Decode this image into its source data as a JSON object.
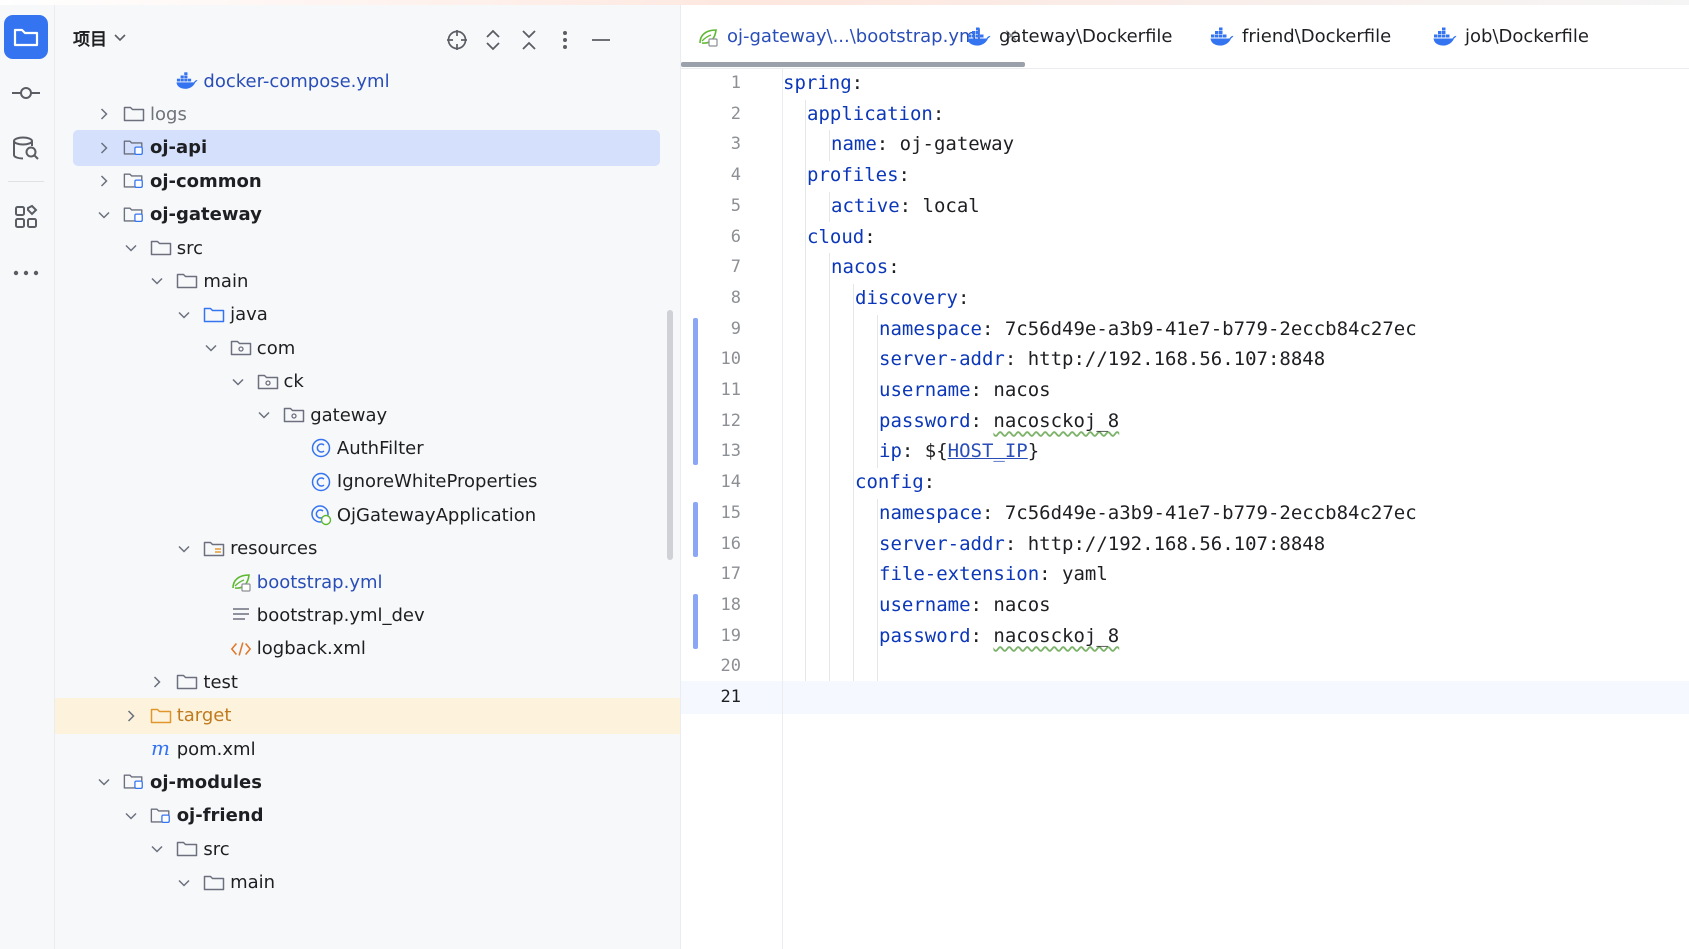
{
  "panel": {
    "title": "项目"
  },
  "tree": [
    {
      "label": "docker-compose.yml",
      "icon": "docker-icon",
      "indent": 4,
      "arrow": "none",
      "style": "blue"
    },
    {
      "label": "logs",
      "icon": "folder-icon",
      "indent": 2,
      "arrow": "right",
      "style": "gray"
    },
    {
      "label": "oj-api",
      "icon": "module-folder-icon",
      "indent": 2,
      "arrow": "right",
      "style": "bold",
      "selected": true
    },
    {
      "label": "oj-common",
      "icon": "module-folder-icon",
      "indent": 2,
      "arrow": "right",
      "style": "bold"
    },
    {
      "label": "oj-gateway",
      "icon": "module-folder-icon",
      "indent": 2,
      "arrow": "down",
      "style": "bold"
    },
    {
      "label": "src",
      "icon": "folder-icon",
      "indent": 3,
      "arrow": "down",
      "style": ""
    },
    {
      "label": "main",
      "icon": "folder-icon",
      "indent": 4,
      "arrow": "down",
      "style": ""
    },
    {
      "label": "java",
      "icon": "source-folder-icon",
      "indent": 5,
      "arrow": "down",
      "style": ""
    },
    {
      "label": "com",
      "icon": "package-icon",
      "indent": 6,
      "arrow": "down",
      "style": ""
    },
    {
      "label": "ck",
      "icon": "package-icon",
      "indent": 7,
      "arrow": "down",
      "style": ""
    },
    {
      "label": "gateway",
      "icon": "package-icon",
      "indent": 8,
      "arrow": "down",
      "style": ""
    },
    {
      "label": "AuthFilter",
      "icon": "class-icon",
      "indent": 9,
      "arrow": "none",
      "style": ""
    },
    {
      "label": "IgnoreWhiteProperties",
      "icon": "class-icon",
      "indent": 9,
      "arrow": "none",
      "style": ""
    },
    {
      "label": "OjGatewayApplication",
      "icon": "spring-class-icon",
      "indent": 9,
      "arrow": "none",
      "style": ""
    },
    {
      "label": "resources",
      "icon": "resources-folder-icon",
      "indent": 5,
      "arrow": "down",
      "style": ""
    },
    {
      "label": "bootstrap.yml",
      "icon": "spring-yaml-icon",
      "indent": 6,
      "arrow": "none",
      "style": "blue"
    },
    {
      "label": "bootstrap.yml_dev",
      "icon": "text-file-icon",
      "indent": 6,
      "arrow": "none",
      "style": ""
    },
    {
      "label": "logback.xml",
      "icon": "xml-icon",
      "indent": 6,
      "arrow": "none",
      "style": ""
    },
    {
      "label": "test",
      "icon": "folder-icon",
      "indent": 4,
      "arrow": "right",
      "style": ""
    },
    {
      "label": "target",
      "icon": "excluded-folder-icon",
      "indent": 3,
      "arrow": "right",
      "style": "orange",
      "highlight": true
    },
    {
      "label": "pom.xml",
      "icon": "maven-icon",
      "indent": 3,
      "arrow": "none",
      "style": ""
    },
    {
      "label": "oj-modules",
      "icon": "module-folder-icon",
      "indent": 2,
      "arrow": "down",
      "style": "bold"
    },
    {
      "label": "oj-friend",
      "icon": "module-folder-icon",
      "indent": 3,
      "arrow": "down",
      "style": "bold"
    },
    {
      "label": "src",
      "icon": "folder-icon",
      "indent": 4,
      "arrow": "down",
      "style": ""
    },
    {
      "label": "main",
      "icon": "folder-icon",
      "indent": 5,
      "arrow": "down",
      "style": ""
    }
  ],
  "tabs": [
    {
      "label": "oj-gateway\\...\\bootstrap.yml",
      "icon": "spring-yaml-icon",
      "active": true
    },
    {
      "label": "gateway\\Dockerfile",
      "icon": "docker-icon"
    },
    {
      "label": "friend\\Dockerfile",
      "icon": "docker-icon"
    },
    {
      "label": "job\\Dockerfile",
      "icon": "docker-icon"
    }
  ],
  "editor": {
    "current_line": 21,
    "lines": [
      {
        "n": "1",
        "indent": 0,
        "key": "spring",
        "sep": ":",
        "value": ""
      },
      {
        "n": "2",
        "indent": 1,
        "key": "application",
        "sep": ":",
        "value": ""
      },
      {
        "n": "3",
        "indent": 2,
        "key": "name",
        "sep": ": ",
        "value": "oj-gateway"
      },
      {
        "n": "4",
        "indent": 1,
        "key": "profiles",
        "sep": ":",
        "value": ""
      },
      {
        "n": "5",
        "indent": 2,
        "key": "active",
        "sep": ": ",
        "value": "local"
      },
      {
        "n": "6",
        "indent": 1,
        "key": "cloud",
        "sep": ":",
        "value": ""
      },
      {
        "n": "7",
        "indent": 2,
        "key": "nacos",
        "sep": ":",
        "value": ""
      },
      {
        "n": "8",
        "indent": 3,
        "key": "discovery",
        "sep": ":",
        "value": ""
      },
      {
        "n": "9",
        "indent": 4,
        "key": "namespace",
        "sep": ": ",
        "value": "7c56d49e-a3b9-41e7-b779-2eccb84c27ec"
      },
      {
        "n": "10",
        "indent": 4,
        "key": "server-addr",
        "sep": ": ",
        "value": "http://192.168.56.107:8848"
      },
      {
        "n": "11",
        "indent": 4,
        "key": "username",
        "sep": ": ",
        "value": "nacos"
      },
      {
        "n": "12",
        "indent": 4,
        "key": "password",
        "sep": ": ",
        "value": "nacosckoj_8",
        "typo": true
      },
      {
        "n": "13",
        "indent": 4,
        "key": "ip",
        "sep": ": ",
        "value": "",
        "ref": "HOST_IP"
      },
      {
        "n": "14",
        "indent": 3,
        "key": "config",
        "sep": ":",
        "value": ""
      },
      {
        "n": "15",
        "indent": 4,
        "key": "namespace",
        "sep": ": ",
        "value": "7c56d49e-a3b9-41e7-b779-2eccb84c27ec"
      },
      {
        "n": "16",
        "indent": 4,
        "key": "server-addr",
        "sep": ": ",
        "value": "http://192.168.56.107:8848"
      },
      {
        "n": "17",
        "indent": 4,
        "key": "file-extension",
        "sep": ": ",
        "value": "yaml"
      },
      {
        "n": "18",
        "indent": 4,
        "key": "username",
        "sep": ": ",
        "value": "nacos"
      },
      {
        "n": "19",
        "indent": 4,
        "key": "password",
        "sep": ": ",
        "value": "nacosckoj_8",
        "typo": true
      },
      {
        "n": "20",
        "indent": 0,
        "key": "",
        "sep": "",
        "value": ""
      },
      {
        "n": "21",
        "indent": 0,
        "key": "",
        "sep": "",
        "value": ""
      }
    ]
  },
  "colors": {
    "accent": "#3574f0",
    "selection": "#d5e1fc",
    "key": "#0b37b8",
    "link_blue": "#2a4eb8",
    "excluded": "#fdf3dc"
  }
}
